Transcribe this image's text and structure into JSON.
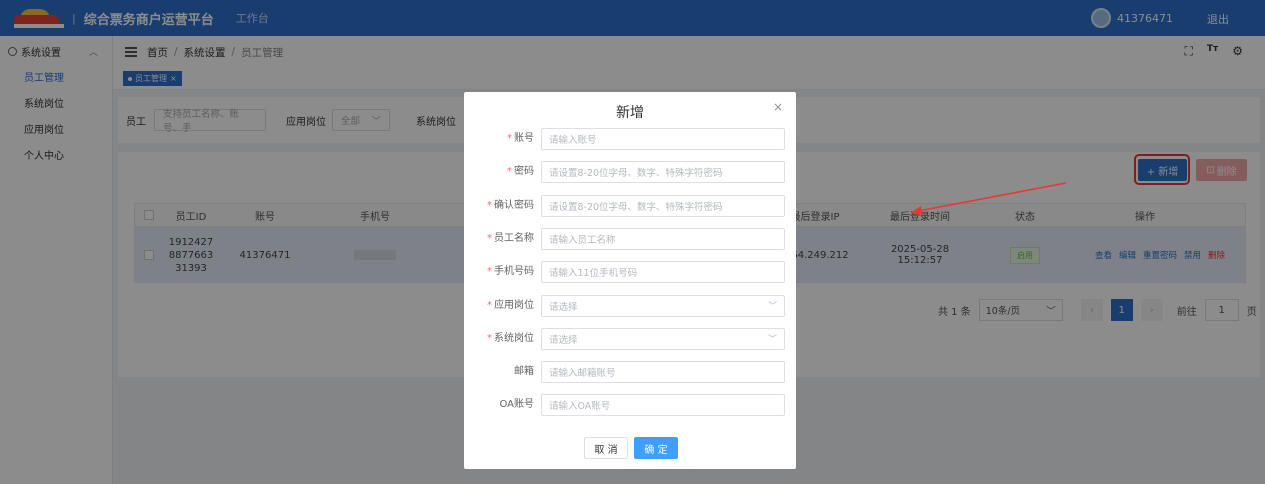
{
  "header": {
    "app_title": "综合票务商户运营平台",
    "separator": "|",
    "workbench": "工作台",
    "user_id": "41376471",
    "logout": "退出"
  },
  "sidebar": {
    "group_label": "系统设置",
    "items": [
      {
        "label": "员工管理",
        "active": true
      },
      {
        "label": "系统岗位"
      },
      {
        "label": "应用岗位"
      },
      {
        "label": "个人中心"
      }
    ]
  },
  "breadcrumb": [
    "首页",
    "系统设置",
    "员工管理"
  ],
  "tag": {
    "label": "员工管理"
  },
  "filter": {
    "employee_label": "员工",
    "employee_placeholder": "支持员工名称、账号、手",
    "app_post_label": "应用岗位",
    "app_post_value": "全部",
    "sys_post_label": "系统岗位"
  },
  "toolbar": {
    "add_label": "+ 新增",
    "delete_label": "删除"
  },
  "table": {
    "headers": [
      "员工ID",
      "账号",
      "手机号",
      "最后登录IP",
      "最后登录时间",
      "状态",
      "操作"
    ],
    "row": {
      "id_lines": [
        "1912427",
        "8877663",
        "31393"
      ],
      "account": "41376471",
      "ip": "64.249.212",
      "last_login": "2025-05-28 15:12:57",
      "status": "启用",
      "ops": [
        "查看",
        "编辑",
        "重置密码",
        "禁用",
        "删除"
      ]
    }
  },
  "pager": {
    "total": "共 1 条",
    "size": "10条/页",
    "current": "1",
    "goto_label": "前往",
    "goto_value": "1",
    "page_suffix": "页"
  },
  "modal": {
    "title": "新增",
    "fields": [
      {
        "label": "账号",
        "required": true,
        "placeholder": "请输入账号"
      },
      {
        "label": "密码",
        "required": true,
        "placeholder": "请设置8-20位字母、数字、特殊字符密码"
      },
      {
        "label": "确认密码",
        "required": true,
        "placeholder": "请设置8-20位字母、数字、特殊字符密码"
      },
      {
        "label": "员工名称",
        "required": true,
        "placeholder": "请输入员工名称"
      },
      {
        "label": "手机号码",
        "required": true,
        "placeholder": "请输入11位手机号码"
      },
      {
        "label": "应用岗位",
        "required": true,
        "placeholder": "请选择",
        "select": true
      },
      {
        "label": "系统岗位",
        "required": true,
        "placeholder": "请选择",
        "select": true
      },
      {
        "label": "邮箱",
        "required": false,
        "placeholder": "请输入邮箱账号"
      },
      {
        "label": "OA账号",
        "required": false,
        "placeholder": "请输入OA账号"
      }
    ],
    "cancel": "取 消",
    "confirm": "确 定"
  },
  "colors": {
    "primary": "#2d6fc9",
    "danger": "#e53935",
    "annotation": "#e53935"
  }
}
